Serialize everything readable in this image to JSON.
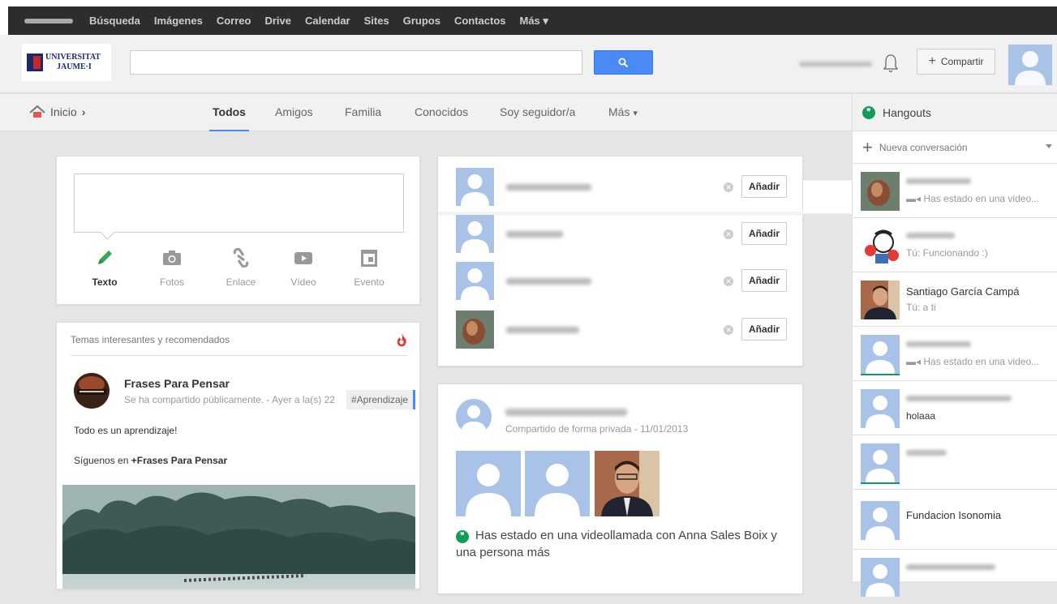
{
  "google_bar": {
    "items": [
      "Búsqueda",
      "Imágenes",
      "Correo",
      "Drive",
      "Calendar",
      "Sites",
      "Grupos",
      "Contactos",
      "Más ▾"
    ]
  },
  "header": {
    "logo_line1": "UNIVERSITAT",
    "logo_line2": "JAUME·I",
    "share_label": "Compartir"
  },
  "nav": {
    "home_label": "Inicio",
    "tabs": [
      {
        "label": "Todos"
      },
      {
        "label": "Amigos"
      },
      {
        "label": "Familia"
      },
      {
        "label": "Conocidos"
      },
      {
        "label": "Soy seguidor/a"
      },
      {
        "label": "Más"
      }
    ]
  },
  "compose": {
    "actions": [
      {
        "label": "Texto",
        "icon": "pencil-icon"
      },
      {
        "label": "Fotos",
        "icon": "camera-icon"
      },
      {
        "label": "Enlace",
        "icon": "link-icon"
      },
      {
        "label": "Vídeo",
        "icon": "video-icon"
      },
      {
        "label": "Evento",
        "icon": "calendar-icon"
      }
    ]
  },
  "topics": {
    "heading": "Temas interesantes y recomendados",
    "post": {
      "author": "Frases Para Pensar",
      "meta": "Se ha compartido públicamente. - Ayer a la(s) 22",
      "tag": "#Aprendizaje",
      "text1": "Todo es un aprendizaje!",
      "text2_prefix": "Síguenos en ",
      "text2_link": "+Frases Para Pensar"
    }
  },
  "suggestions": {
    "add_label": "Añadir",
    "dismiss_glyph": "✕"
  },
  "hangout_post": {
    "meta_suffix": "Compartido de forma privada - 11/01/2013",
    "text": "Has estado en una videollamada con Anna Sales Boix y una persona más"
  },
  "hangouts": {
    "title": "Hangouts",
    "new_conversation": "Nueva conversación",
    "items": [
      {
        "sub": "Has estado en una video..."
      },
      {
        "sub": "Tú: Funcionando :)"
      },
      {
        "name": "Santiago García Campá",
        "sub": "Tú: a ti"
      },
      {
        "sub": "Has estado en una video..."
      },
      {
        "sub": "holaaa"
      },
      {
        "sub": ""
      },
      {
        "name": "Fundacion Isonomia"
      }
    ]
  },
  "colors": {
    "accent": "#4a8af4",
    "hangouts_green": "#0f9d58",
    "text_pencil": "#34a853",
    "fire": "#e53935"
  }
}
